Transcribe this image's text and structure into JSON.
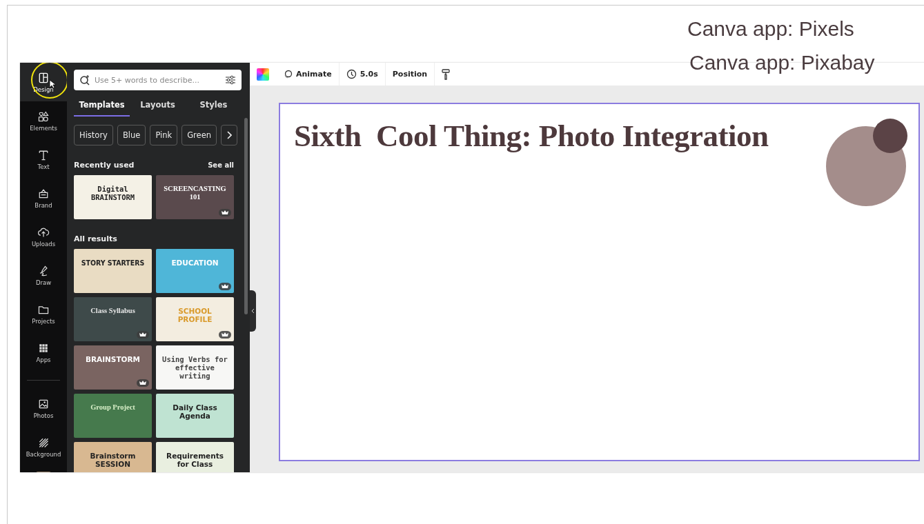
{
  "slide_notes": [
    "Canva app: Pixels",
    "Canva app: Pixabay"
  ],
  "rail": [
    {
      "label": "Design",
      "selected": true
    },
    {
      "label": "Elements",
      "selected": false
    },
    {
      "label": "Text",
      "selected": false
    },
    {
      "label": "Brand",
      "selected": false
    },
    {
      "label": "Uploads",
      "selected": false
    },
    {
      "label": "Draw",
      "selected": false
    },
    {
      "label": "Projects",
      "selected": false
    },
    {
      "label": "Apps",
      "selected": false
    },
    {
      "label": "Photos",
      "selected": false
    },
    {
      "label": "Background",
      "selected": false
    }
  ],
  "panel": {
    "search": {
      "placeholder": "Use 5+ words to describe..."
    },
    "tabs": [
      {
        "label": "Templates",
        "selected": true
      },
      {
        "label": "Layouts",
        "selected": false
      },
      {
        "label": "Styles",
        "selected": false
      }
    ],
    "chips": [
      "History",
      "Blue",
      "Pink",
      "Green"
    ],
    "recent": {
      "heading": "Recently used",
      "link": "See all",
      "items": [
        {
          "title": "Digital BRAINSTORM",
          "premium": false
        },
        {
          "title": "SCREENCASTING 101",
          "premium": true
        }
      ]
    },
    "results": {
      "heading": "All results",
      "items": [
        {
          "title": "STORY STARTERS",
          "premium": false
        },
        {
          "title": "EDUCATION",
          "premium": true
        },
        {
          "title": "Class Syllabus",
          "premium": true
        },
        {
          "title": "SCHOOL PROFILE",
          "premium": true
        },
        {
          "title": "BRAINSTORM",
          "premium": true
        },
        {
          "title": "Using Verbs for effective writing",
          "premium": false
        },
        {
          "title": "Group Project",
          "premium": false
        },
        {
          "title": "Daily Class Agenda",
          "premium": false
        },
        {
          "title": "Brainstorm SESSION",
          "premium": false
        },
        {
          "title": "Requirements for Class",
          "premium": false
        }
      ]
    }
  },
  "toolbar": {
    "animate": "Animate",
    "duration": "5.0s",
    "position": "Position"
  },
  "slide": {
    "title": "Sixth  Cool Thing: Photo Integration"
  }
}
